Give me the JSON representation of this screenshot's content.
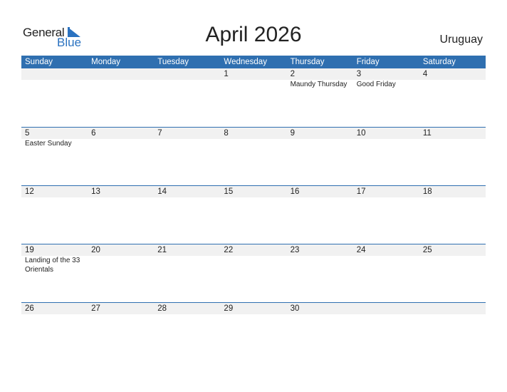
{
  "logo": {
    "word1": "General",
    "word2": "Blue"
  },
  "title": "April 2026",
  "country": "Uruguay",
  "colors": {
    "header_bg": "#2f6fb0",
    "brand_blue": "#2a72c0",
    "date_strip": "#f1f1f1"
  },
  "weekdays": [
    "Sunday",
    "Monday",
    "Tuesday",
    "Wednesday",
    "Thursday",
    "Friday",
    "Saturday"
  ],
  "weeks": [
    [
      {
        "day": "",
        "event": ""
      },
      {
        "day": "",
        "event": ""
      },
      {
        "day": "",
        "event": ""
      },
      {
        "day": "1",
        "event": ""
      },
      {
        "day": "2",
        "event": "Maundy Thursday"
      },
      {
        "day": "3",
        "event": "Good Friday"
      },
      {
        "day": "4",
        "event": ""
      }
    ],
    [
      {
        "day": "5",
        "event": "Easter Sunday"
      },
      {
        "day": "6",
        "event": ""
      },
      {
        "day": "7",
        "event": ""
      },
      {
        "day": "8",
        "event": ""
      },
      {
        "day": "9",
        "event": ""
      },
      {
        "day": "10",
        "event": ""
      },
      {
        "day": "11",
        "event": ""
      }
    ],
    [
      {
        "day": "12",
        "event": ""
      },
      {
        "day": "13",
        "event": ""
      },
      {
        "day": "14",
        "event": ""
      },
      {
        "day": "15",
        "event": ""
      },
      {
        "day": "16",
        "event": ""
      },
      {
        "day": "17",
        "event": ""
      },
      {
        "day": "18",
        "event": ""
      }
    ],
    [
      {
        "day": "19",
        "event": "Landing of the 33 Orientals"
      },
      {
        "day": "20",
        "event": ""
      },
      {
        "day": "21",
        "event": ""
      },
      {
        "day": "22",
        "event": ""
      },
      {
        "day": "23",
        "event": ""
      },
      {
        "day": "24",
        "event": ""
      },
      {
        "day": "25",
        "event": ""
      }
    ],
    [
      {
        "day": "26",
        "event": ""
      },
      {
        "day": "27",
        "event": ""
      },
      {
        "day": "28",
        "event": ""
      },
      {
        "day": "29",
        "event": ""
      },
      {
        "day": "30",
        "event": ""
      },
      {
        "day": "",
        "event": ""
      },
      {
        "day": "",
        "event": ""
      }
    ]
  ]
}
